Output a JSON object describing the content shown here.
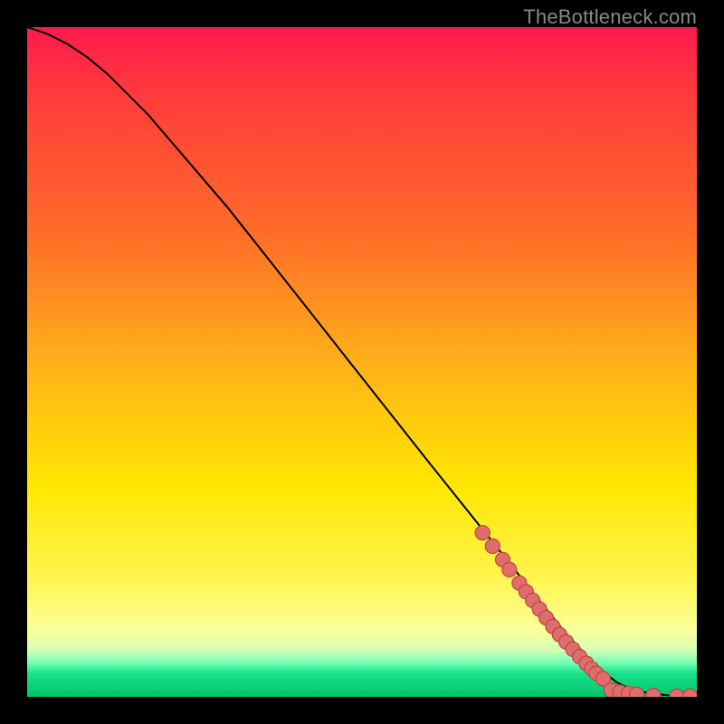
{
  "watermark": "TheBottleneck.com",
  "chart_data": {
    "type": "line",
    "title": "",
    "xlabel": "",
    "ylabel": "",
    "xlim": [
      0,
      100
    ],
    "ylim": [
      0,
      100
    ],
    "series": [
      {
        "name": "curve",
        "x": [
          0,
          3,
          6,
          9,
          12,
          18,
          30,
          45,
          60,
          72,
          80,
          85,
          88,
          90,
          92,
          94,
          96,
          100
        ],
        "y": [
          100,
          99,
          97.5,
          95.5,
          93,
          87,
          73,
          54,
          35,
          20,
          10,
          4.5,
          2.2,
          1.2,
          0.7,
          0.4,
          0.2,
          0.1
        ]
      }
    ],
    "markers": [
      {
        "x": 68,
        "y": 24.5
      },
      {
        "x": 69.5,
        "y": 22.5
      },
      {
        "x": 71,
        "y": 20.5
      },
      {
        "x": 72,
        "y": 19
      },
      {
        "x": 73.5,
        "y": 17
      },
      {
        "x": 74.5,
        "y": 15.7
      },
      {
        "x": 75.5,
        "y": 14.4
      },
      {
        "x": 76.5,
        "y": 13.1
      },
      {
        "x": 77.5,
        "y": 11.8
      },
      {
        "x": 78.5,
        "y": 10.5
      },
      {
        "x": 79.5,
        "y": 9.3
      },
      {
        "x": 80.5,
        "y": 8.2
      },
      {
        "x": 81.5,
        "y": 7.1
      },
      {
        "x": 82.5,
        "y": 6.0
      },
      {
        "x": 83.5,
        "y": 5.0
      },
      {
        "x": 84.3,
        "y": 4.2
      },
      {
        "x": 85.0,
        "y": 3.5
      },
      {
        "x": 86.0,
        "y": 2.7
      },
      {
        "x": 87.2,
        "y": 1.0
      },
      {
        "x": 88.5,
        "y": 0.7
      },
      {
        "x": 89.8,
        "y": 0.5
      },
      {
        "x": 91.0,
        "y": 0.35
      },
      {
        "x": 93.5,
        "y": 0.2
      },
      {
        "x": 97.0,
        "y": 0.1
      },
      {
        "x": 99.0,
        "y": 0.1
      }
    ],
    "marker_style": {
      "radius": 8,
      "fill": "#e06c6c",
      "stroke": "#b84848",
      "stroke_width": 1.2
    },
    "line_style": {
      "stroke": "#000000",
      "width": 2
    }
  }
}
